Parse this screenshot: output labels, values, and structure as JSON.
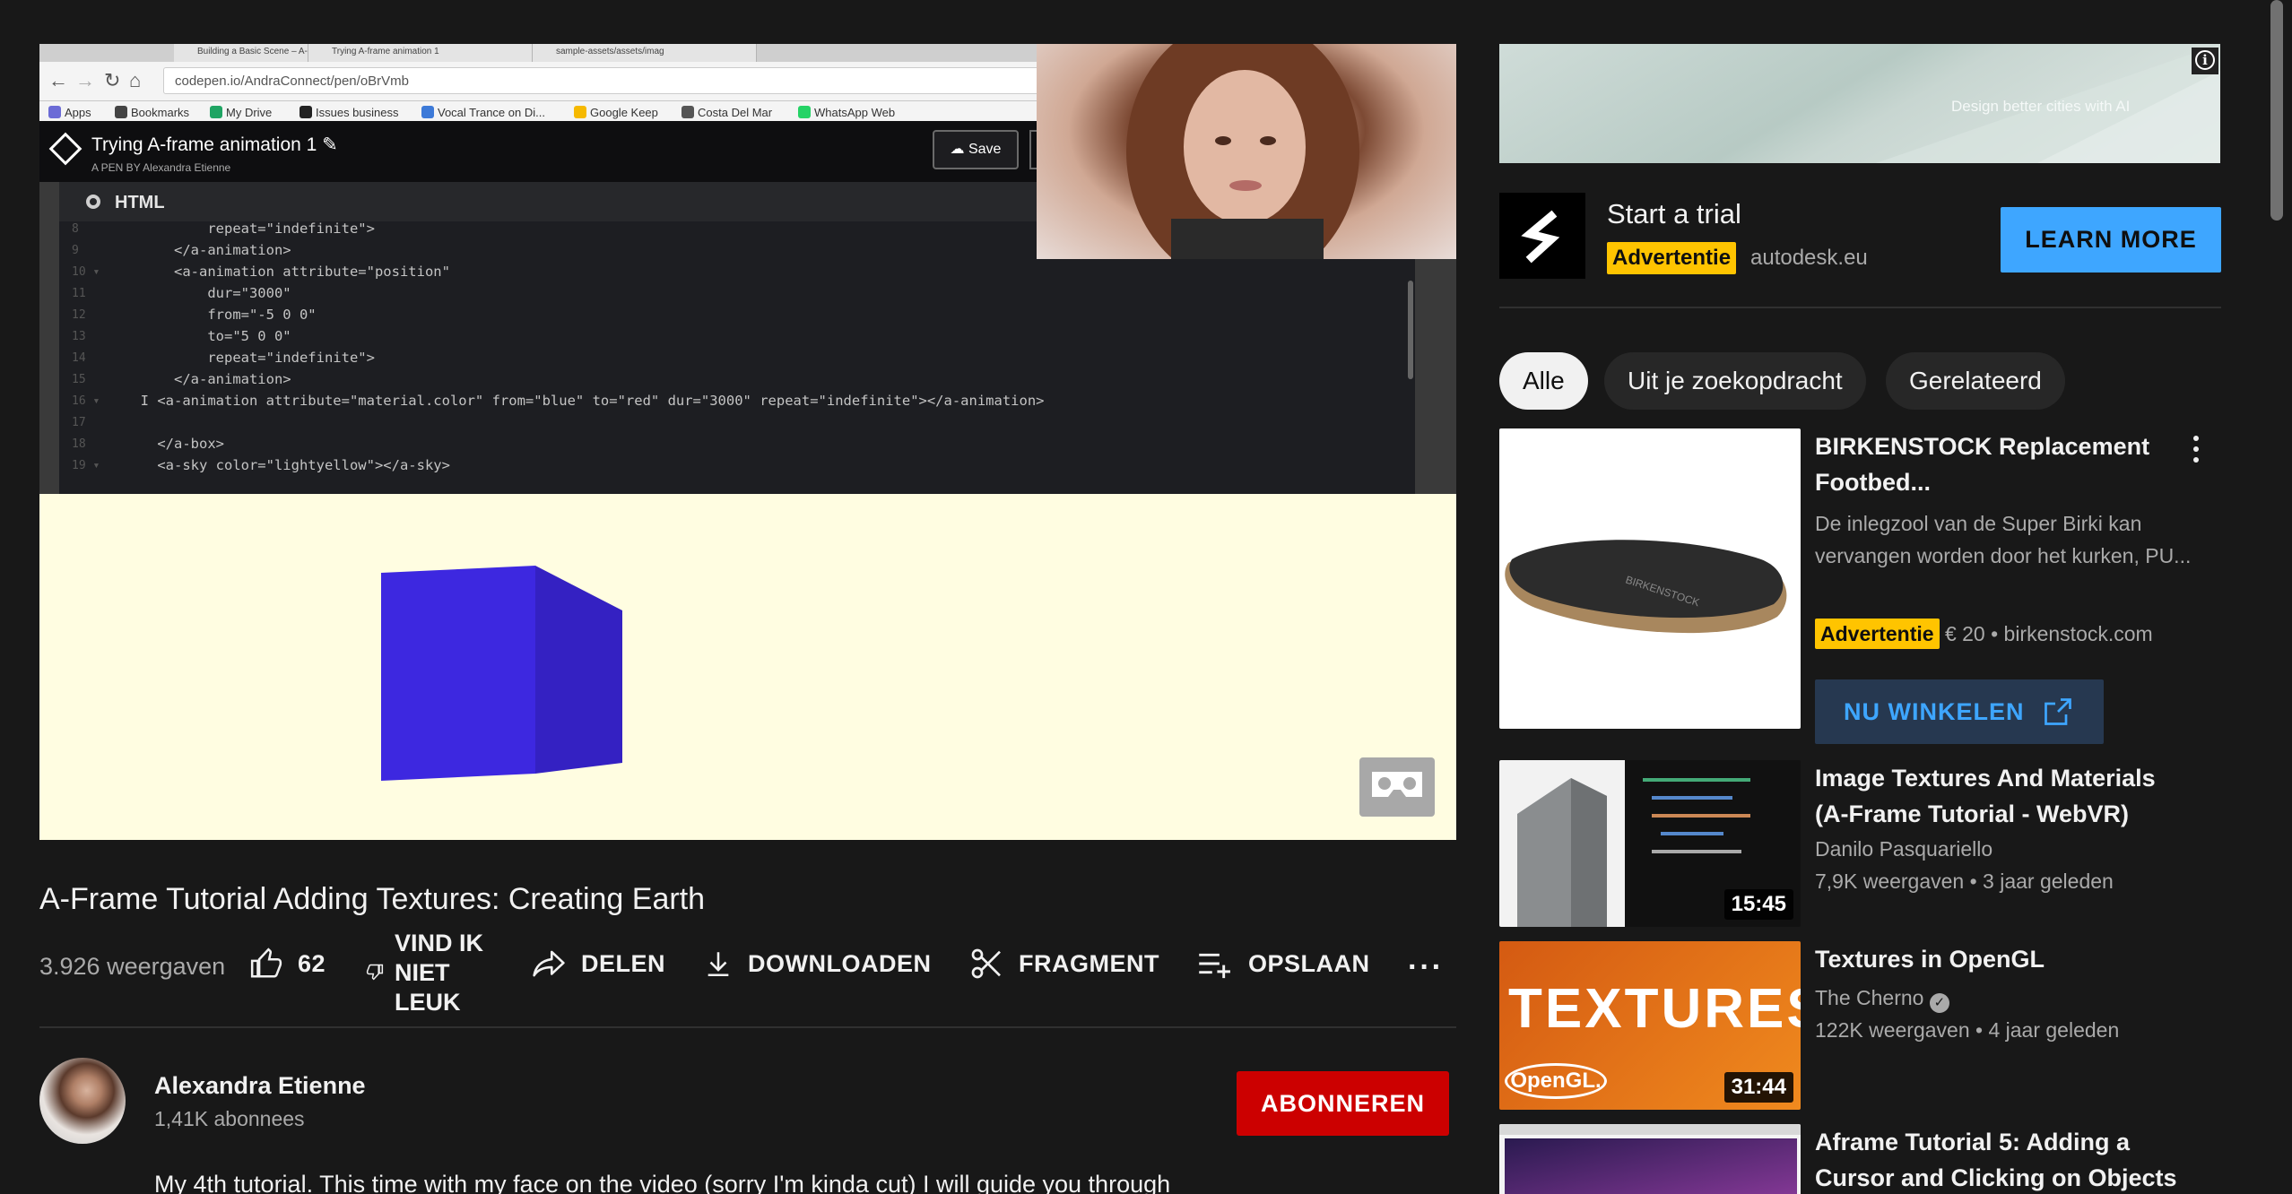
{
  "video": {
    "browser": {
      "tabs": [
        "Building a Basic Scene – A-F",
        "Trying A-frame animation 1",
        "sample-assets/assets/imag"
      ],
      "url": "codepen.io/AndraConnect/pen/oBrVmb",
      "bookmarks": [
        "Apps",
        "Bookmarks",
        "My Drive",
        "Issues business",
        "Vocal Trance on Di...",
        "Google Keep",
        "Costa Del Mar",
        "WhatsApp Web"
      ]
    },
    "codepen": {
      "title": "Trying A-frame animation 1 ✎",
      "byline": "A PEN BY Alexandra Etienne",
      "save": "Save",
      "panel": "HTML",
      "code_lines": [
        {
          "n": "8",
          "t": "          repeat=\"indefinite\">"
        },
        {
          "n": "9",
          "t": "      </a-animation>"
        },
        {
          "n": "10 ▾",
          "t": "      <a-animation attribute=\"position\""
        },
        {
          "n": "11",
          "t": "          dur=\"3000\""
        },
        {
          "n": "12",
          "t": "          from=\"-5 0 0\""
        },
        {
          "n": "13",
          "t": "          to=\"5 0 0\""
        },
        {
          "n": "14",
          "t": "          repeat=\"indefinite\">"
        },
        {
          "n": "15",
          "t": "      </a-animation>"
        },
        {
          "n": "16 ▾",
          "t": "  I <a-animation attribute=\"material.color\" from=\"blue\" to=\"red\" dur=\"3000\" repeat=\"indefinite\"></a-animation>"
        },
        {
          "n": "17",
          "t": ""
        },
        {
          "n": "18",
          "t": "    </a-box>"
        },
        {
          "n": "19 ▾",
          "t": "    <a-sky color=\"lightyellow\"></a-sky>"
        }
      ]
    },
    "title": "A-Frame Tutorial Adding Textures: Creating Earth",
    "views": "3.926 weergaven",
    "likes": "62",
    "dislike_label": "VIND IK NIET LEUK",
    "actions": {
      "share": "DELEN",
      "download": "DOWNLOADEN",
      "clip": "FRAGMENT",
      "save": "OPSLAAN"
    },
    "more": "···"
  },
  "channel": {
    "name": "Alexandra Etienne",
    "subscribers": "1,41K abonnees",
    "subscribe": "ABONNEREN",
    "description": "My 4th tutorial. This time with my face on the video (sorry I'm kinda cut) I will guide you through"
  },
  "sidebar": {
    "banner_text": "Design better cities with AI",
    "ad": {
      "title": "Start a trial",
      "badge": "Advertentie",
      "domain": "autodesk.eu",
      "cta": "LEARN MORE"
    },
    "chips": [
      "Alle",
      "Uit je zoekopdracht",
      "Gerelateerd"
    ],
    "shopping_ad": {
      "title": "BIRKENSTOCK Replacement Footbed...",
      "description": "De inlegzool van de Super Birki kan vervangen worden door het kurken, PU...",
      "badge": "Advertentie",
      "price_domain": "€ 20 • birkenstock.com",
      "cta": "NU WINKELEN"
    },
    "videos": [
      {
        "title": "Image Textures And Materials (A-Frame Tutorial - WebVR)",
        "channel": "Danilo Pasquariello",
        "meta": "7,9K weergaven • 3 jaar geleden",
        "duration": "15:45"
      },
      {
        "title": "Textures in OpenGL",
        "channel": "The Cherno",
        "meta": "122K weergaven • 4 jaar geleden",
        "duration": "31:44",
        "thumb_text": "TEXTURES",
        "thumb_logo": "OpenGL."
      },
      {
        "title": "Aframe Tutorial 5: Adding a Cursor and Clicking on Objects",
        "channel": "",
        "meta": "",
        "duration": ""
      }
    ]
  },
  "colors": {
    "background": "#181818",
    "subscribe": "#cc0000",
    "learn_more": "#3ea6ff",
    "ad_badge": "#ffc400",
    "cube": "#3d28e0"
  }
}
